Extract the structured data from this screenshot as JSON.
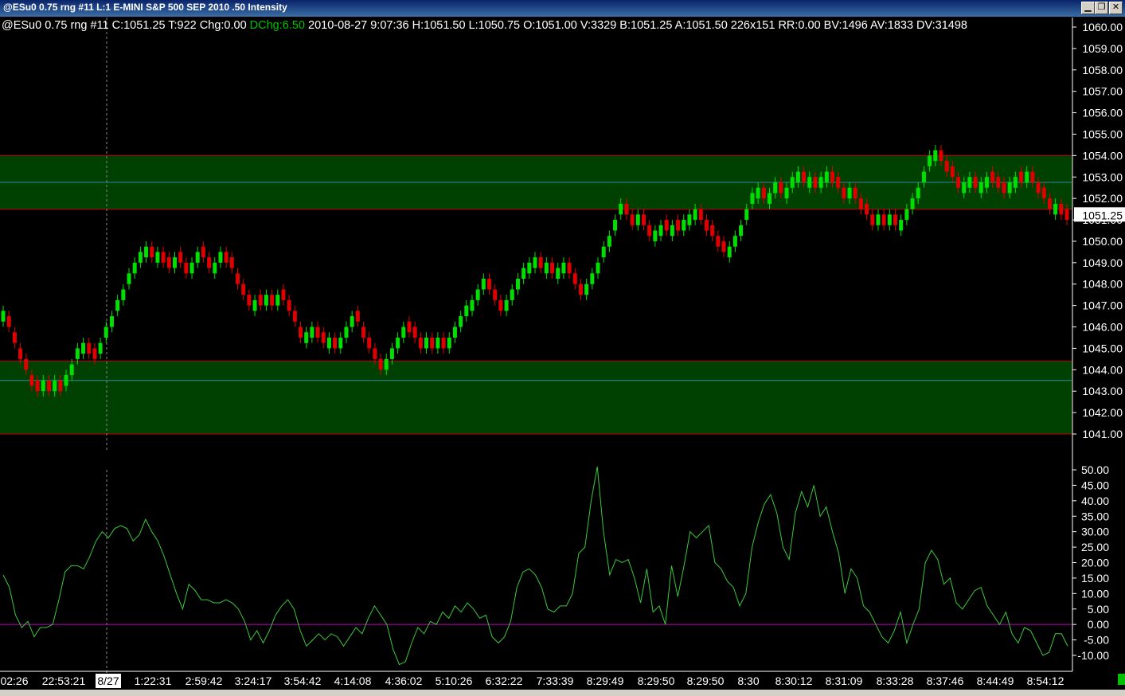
{
  "window": {
    "title": "@ESu0  0.75 rng  #11  L:1  E-MINI S&P 500 SEP 2010  .50 Intensity",
    "minimize": "▁",
    "restore": "❐",
    "close": "✕"
  },
  "status": {
    "prefix": "@ESu0  0.75 rng  #11 C:1051.25 T:922 Chg:0.00 ",
    "dchg": "DChg:6.50",
    "suffix": " 2010-08-27 9:07:36 H:1051.50 L:1050.75 O:1051.00 V:3329 B:1051.25 A:1051.50 226x151 RR:0.00 BV:1496 AV:1833 DV:31498"
  },
  "colors": {
    "up": "#00e000",
    "down": "#e00000",
    "zone_fill": "#004000",
    "zone_edge": "#c00000",
    "zone_mid": "#2a8aa0",
    "osc": "#3cc83c",
    "zero": "#c000c0",
    "axis_text": "#ffffff"
  },
  "chart_data": [
    {
      "type": "candlestick",
      "title": "",
      "ylim": [
        1040.7,
        1060.3
      ],
      "y_ticks": [
        "1060.00",
        "1059.00",
        "1058.00",
        "1057.00",
        "1056.00",
        "1055.00",
        "1054.00",
        "1053.00",
        "1052.00",
        "1051.00",
        "1050.00",
        "1049.00",
        "1048.00",
        "1047.00",
        "1046.00",
        "1045.00",
        "1044.00",
        "1043.00",
        "1042.00",
        "1041.00"
      ],
      "last_price_label": "1051.25",
      "zones": [
        {
          "top": 1054.0,
          "mid": 1052.75,
          "bottom": 1051.5
        },
        {
          "top": 1044.4,
          "mid": 1043.5,
          "bottom": 1041.0
        }
      ],
      "closes": [
        1046.75,
        1046.0,
        1045.25,
        1044.5,
        1044.0,
        1043.25,
        1043.0,
        1043.5,
        1043.0,
        1043.5,
        1043.0,
        1043.75,
        1044.25,
        1045.0,
        1045.25,
        1044.75,
        1044.5,
        1045.25,
        1046.0,
        1046.5,
        1047.25,
        1047.75,
        1048.5,
        1049.0,
        1049.5,
        1049.75,
        1049.25,
        1049.5,
        1049.0,
        1048.75,
        1049.25,
        1049.0,
        1048.5,
        1049.0,
        1049.5,
        1049.25,
        1048.75,
        1049.0,
        1049.5,
        1049.0,
        1048.75,
        1048.0,
        1047.5,
        1047.0,
        1047.25,
        1047.0,
        1047.5,
        1047.0,
        1047.5,
        1047.25,
        1046.75,
        1046.25,
        1045.5,
        1045.75,
        1046.0,
        1045.5,
        1045.25,
        1045.5,
        1045.0,
        1045.5,
        1046.0,
        1046.5,
        1046.25,
        1045.5,
        1045.0,
        1044.5,
        1044.0,
        1044.5,
        1045.0,
        1045.5,
        1046.0,
        1045.75,
        1045.5,
        1045.0,
        1045.5,
        1045.0,
        1045.5,
        1045.0,
        1045.5,
        1046.0,
        1046.5,
        1047.0,
        1047.25,
        1047.75,
        1048.25,
        1047.75,
        1047.25,
        1046.75,
        1047.25,
        1047.75,
        1048.25,
        1048.75,
        1049.0,
        1049.25,
        1048.75,
        1049.0,
        1048.5,
        1048.75,
        1049.0,
        1048.5,
        1048.0,
        1047.5,
        1048.0,
        1048.5,
        1049.0,
        1049.75,
        1050.25,
        1051.0,
        1051.75,
        1051.25,
        1050.75,
        1051.25,
        1050.75,
        1050.25,
        1050.5,
        1050.75,
        1050.5,
        1050.75,
        1050.5,
        1051.0,
        1051.25,
        1051.5,
        1051.0,
        1050.5,
        1050.25,
        1049.75,
        1049.5,
        1049.75,
        1050.25,
        1050.75,
        1051.5,
        1052.25,
        1052.5,
        1052.0,
        1052.25,
        1052.75,
        1052.25,
        1052.5,
        1053.0,
        1053.25,
        1052.75,
        1053.0,
        1052.5,
        1053.0,
        1053.25,
        1052.75,
        1052.5,
        1052.0,
        1052.5,
        1052.0,
        1051.5,
        1051.25,
        1050.75,
        1051.25,
        1050.75,
        1051.25,
        1050.75,
        1051.0,
        1051.5,
        1052.0,
        1052.5,
        1053.25,
        1054.0,
        1054.25,
        1053.75,
        1053.25,
        1053.0,
        1052.5,
        1052.75,
        1053.0,
        1052.5,
        1052.75,
        1053.0,
        1052.75,
        1052.5,
        1052.25,
        1052.75,
        1053.0,
        1052.75,
        1053.25,
        1052.75,
        1052.25,
        1052.0,
        1051.5,
        1051.75,
        1051.25,
        1051.0
      ],
      "x_tick_labels": [
        "02:26",
        "22:53:21",
        "8/27",
        "1:22:31",
        "2:59:42",
        "3:24:17",
        "3:54:42",
        "4:14:08",
        "4:36:02",
        "5:10:26",
        "6:32:22",
        "7:33:39",
        "8:29:49",
        "8:29:50",
        "8:29:50",
        "8:30",
        "8:30:12",
        "8:31:09",
        "8:33:28",
        "8:37:46",
        "8:44:49",
        "8:54:12"
      ],
      "session_break_label": "8/27"
    },
    {
      "type": "line",
      "name": "oscillator",
      "ylim": [
        -13.0,
        51.0
      ],
      "y_ticks": [
        "50.00",
        "45.00",
        "40.00",
        "35.00",
        "30.00",
        "25.00",
        "20.00",
        "15.00",
        "10.00",
        "5.00",
        "0.00",
        "-5.00",
        "-10.00"
      ],
      "zero_line": 0,
      "values": [
        16,
        12,
        3,
        -1,
        1,
        -4,
        -1,
        -1,
        0,
        8,
        17,
        19,
        19,
        18,
        22,
        27,
        30,
        28,
        31,
        32,
        31,
        27,
        29,
        34,
        30,
        27,
        22,
        16,
        10,
        5,
        13,
        11,
        8,
        8,
        7,
        7,
        8,
        7,
        5,
        1,
        -5,
        -2,
        -6,
        -2,
        3,
        6,
        8,
        5,
        -2,
        -7,
        -5,
        -3,
        -5,
        -3,
        -4,
        -7,
        -4,
        -1,
        -3,
        2,
        6,
        3,
        0,
        -8,
        -13,
        -12,
        -6,
        -1,
        -3,
        1,
        0,
        4,
        2,
        6,
        4,
        7,
        5,
        2,
        3,
        -4,
        -6,
        -4,
        1,
        12,
        17,
        18,
        16,
        12,
        5,
        4,
        6,
        6,
        10,
        23,
        25,
        40,
        51,
        30,
        16,
        21,
        20,
        21,
        15,
        7,
        18,
        4,
        6,
        0,
        19,
        9,
        19,
        30,
        28,
        30,
        32,
        20,
        18,
        14,
        12,
        6,
        10,
        25,
        33,
        39,
        42,
        36,
        25,
        21,
        36,
        43,
        38,
        45,
        35,
        38,
        30,
        23,
        10,
        18,
        15,
        6,
        4,
        0,
        -4,
        -6,
        -2,
        4,
        -6,
        0,
        5,
        20,
        24,
        21,
        13,
        15,
        7,
        5,
        8,
        11,
        12,
        6,
        3,
        0,
        4,
        -3,
        -6,
        -1,
        -2,
        -6,
        -10,
        -9,
        -3,
        -3,
        -7
      ],
      "vertical_separators": [
        18,
        110
      ]
    }
  ]
}
